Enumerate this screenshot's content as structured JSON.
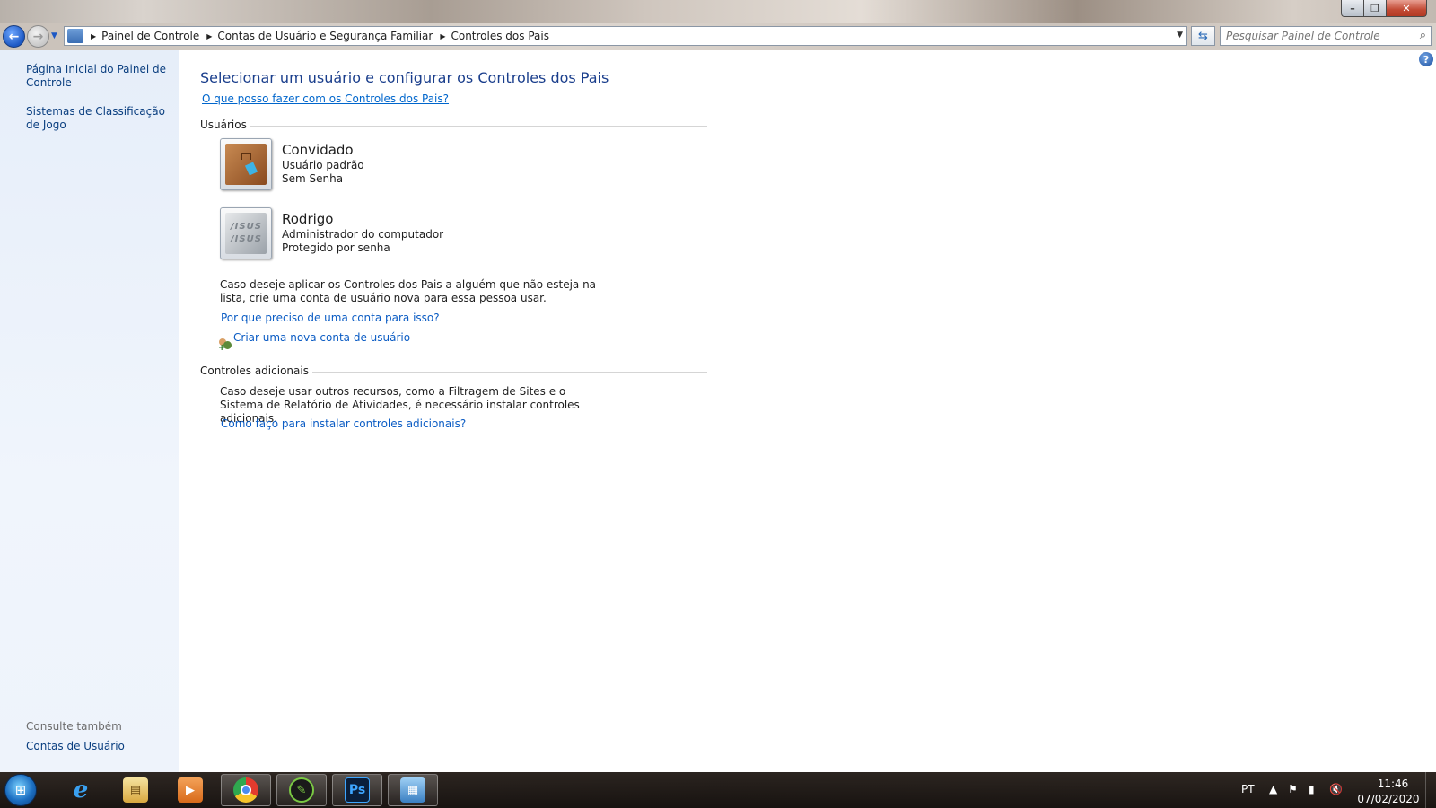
{
  "window": {
    "minimize_glyph": "–",
    "maximize_glyph": "❐",
    "close_glyph": "✕"
  },
  "navbar": {
    "back_glyph": "←",
    "forward_glyph": "→",
    "breadcrumbs": [
      "Painel de Controle",
      "Contas de Usuário e Segurança Familiar",
      "Controles dos Pais"
    ],
    "search_placeholder": "Pesquisar Painel de Controle"
  },
  "sidebar": {
    "items": [
      {
        "label": "Página Inicial do Painel de Controle"
      },
      {
        "label": "Sistemas de Classificação de Jogo"
      }
    ],
    "see_also_heading": "Consulte também",
    "see_also_items": [
      {
        "label": "Contas de Usuário"
      }
    ]
  },
  "main": {
    "title": "Selecionar um usuário e configurar os Controles dos Pais",
    "help_link": "O que posso fazer com os Controles dos Pais?",
    "users_heading": "Usuários",
    "users": [
      {
        "name": "Convidado",
        "type": "Usuário padrão",
        "password": "Sem Senha"
      },
      {
        "name": "Rodrigo",
        "type": "Administrador do computador",
        "password": "Protegido por senha"
      }
    ],
    "create_text": "Caso deseje aplicar os Controles dos Pais a alguém que não esteja na lista, crie uma conta de usuário nova para essa pessoa usar.",
    "why_account_link": "Por que preciso de uma conta para isso?",
    "create_account_link": "Criar uma nova conta de usuário",
    "additional_heading": "Controles adicionais",
    "additional_text": "Caso deseje usar outros recursos, como a Filtragem de Sites e o Sistema de Relatório de Atividades, é necessário instalar controles adicionais.",
    "install_link": "Como faço para instalar controles adicionais?"
  },
  "taskbar": {
    "photoshop_label": "Ps",
    "language": "PT",
    "time": "11:46",
    "date": "07/02/2020"
  },
  "colors": {
    "title_blue": "#1a3e8c",
    "link_blue": "#0b5cc4",
    "sidebar_bg": "#e6eef9"
  }
}
